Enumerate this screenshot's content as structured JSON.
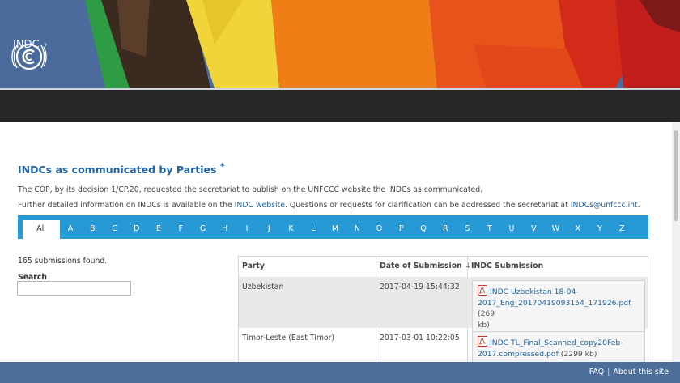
{
  "header": {
    "brand": "INDC",
    "chevron": "›"
  },
  "page": {
    "title": "INDCs as communicated by Parties",
    "title_mark": "*",
    "line1": "The COP, by its decision 1/CP.20, requested the secretariat to publish on the UNFCCC website the INDCs as communicated.",
    "line2_prefix": "Further detailed information on INDCs is available on the ",
    "line2_link": "INDC website",
    "line2_middle": ". Questions or requests for clarification can be addressed the secretariat at ",
    "line2_email": "INDCs@unfccc.int",
    "line2_suffix": "."
  },
  "alphabet": {
    "active": "All",
    "letters": [
      "A",
      "B",
      "C",
      "D",
      "E",
      "F",
      "G",
      "H",
      "I",
      "J",
      "K",
      "L",
      "M",
      "N",
      "O",
      "P",
      "Q",
      "R",
      "S",
      "T",
      "U",
      "V",
      "W",
      "X",
      "Y",
      "Z"
    ]
  },
  "results": {
    "count_text": "165 submissions found.",
    "search_label": "Search",
    "search_value": ""
  },
  "table": {
    "headers": {
      "party": "Party",
      "date": "Date of Submission",
      "sort_icon": "↓",
      "submission": "INDC Submission"
    },
    "rows": [
      {
        "party": "Uzbekistan",
        "date": "2017-04-19 15:44:32",
        "file_line1": "INDC Uzbekistan 18-04-",
        "file_line2": "2017_Eng_20170419093154_171926.pdf",
        "size_a": " (269",
        "size_b": "kb)"
      },
      {
        "party": "Timor-Leste (East Timor)",
        "date": "2017-03-01 10:22:05",
        "file_line1": "INDC TL_Final_Scanned_copy20Feb-",
        "file_line2": "2017.compressed.pdf",
        "size_a": " (2299 kb)",
        "size_b": ""
      }
    ]
  },
  "footer": {
    "faq": "FAQ",
    "separator": "|",
    "about": "About this site"
  }
}
